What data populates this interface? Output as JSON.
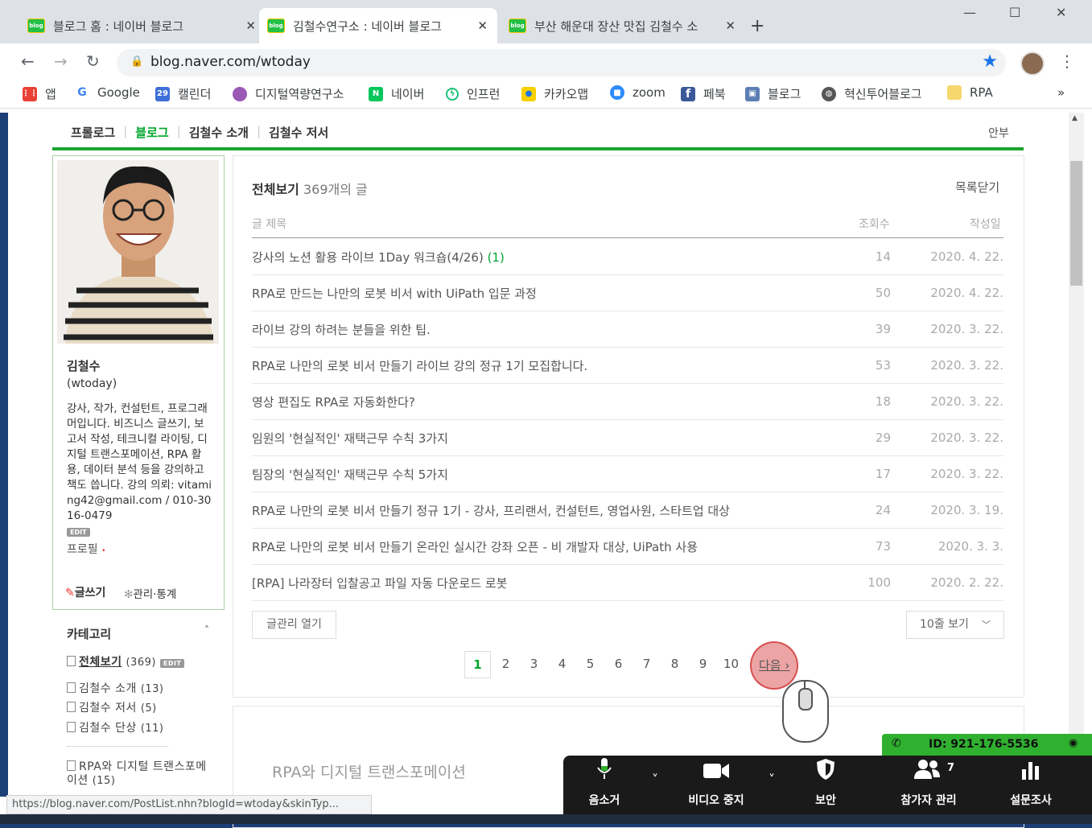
{
  "tabs": [
    {
      "title": "블로그 홈 : 네이버 블로그",
      "close": "✕"
    },
    {
      "title": "김철수연구소 : 네이버 블로그",
      "close": "✕"
    },
    {
      "title": "부산 해운대 장산 맛집 김철수 소",
      "close": "✕"
    }
  ],
  "favicon_text": "blog",
  "new_tab": "+",
  "window_controls": {
    "min": "—",
    "max": "☐",
    "close": "✕"
  },
  "nav": {
    "back": "←",
    "forward": "→",
    "reload": "↻",
    "menu": "⋮"
  },
  "address": {
    "url": "blog.naver.com/wtoday",
    "lock": "🔒",
    "star": "★"
  },
  "bookmarks": [
    {
      "label": "앱",
      "icon": "apps-icon",
      "color": "#e94235"
    },
    {
      "label": "Google",
      "icon": "google-icon",
      "color": "#4285f4"
    },
    {
      "label": "캘린더",
      "icon": "calendar-icon",
      "color": "#3f6fd8"
    },
    {
      "label": "디지털역량연구소",
      "icon": "person-icon",
      "color": "#9b59b6"
    },
    {
      "label": "네이버",
      "icon": "naver-icon",
      "color": "#03c75a"
    },
    {
      "label": "인프런",
      "icon": "inflearn-icon",
      "color": "#1dc078"
    },
    {
      "label": "카카오맵",
      "icon": "map-pin-icon",
      "color": "#f7d000"
    },
    {
      "label": "zoom",
      "icon": "zoom-icon",
      "color": "#2d8cff"
    },
    {
      "label": "페북",
      "icon": "facebook-icon",
      "color": "#3b5998"
    },
    {
      "label": "블로그",
      "icon": "truck-icon",
      "color": "#5b7fb5"
    },
    {
      "label": "혁신투어블로그",
      "icon": "globe-icon",
      "color": "#555555"
    },
    {
      "label": "RPA",
      "icon": "folder-icon",
      "color": "#f5d76e"
    }
  ],
  "bookmarks_more": "»",
  "blog_menu": [
    "프롤로그",
    "블로그",
    "김철수 소개",
    "김철수 저서"
  ],
  "blog_menu_sep": "|",
  "anbu": "안부",
  "profile": {
    "name": "김철수",
    "id": "(wtoday)",
    "description": "강사, 작가, 컨설턴트, 프로그래머입니다. 비즈니스 글쓰기, 보고서 작성, 테크니컬 라이팅, 디지털 트랜스포메이션, RPA 활용, 데이터 분석 등을 강의하고 책도 씁니다. 강의 의뢰: vitaming42@gmail.com / 010-3016-0479",
    "edit": "EDIT",
    "profile_link": "프로필",
    "profile_dot": "•",
    "write": "글쓰기",
    "manage": "관리·통계"
  },
  "categories": {
    "title": "카테고리",
    "caret": "˄",
    "items": [
      {
        "label": "전체보기",
        "count": "(369)",
        "edit": "EDIT"
      },
      {
        "label": "김철수 소개",
        "count": "(13)"
      },
      {
        "label": "김철수 저서",
        "count": "(5)"
      },
      {
        "label": "김철수 단상",
        "count": "(11)"
      },
      {
        "label": "RPA와 디지털 트랜스포메이션",
        "count": "(15)"
      }
    ]
  },
  "list": {
    "title": "전체보기",
    "count": "369개의 글",
    "close": "목록닫기",
    "col_title": "글 제목",
    "col_views": "조회수",
    "col_date": "작성일",
    "rows": [
      {
        "title": "강사의 노션 활용 라이브 1Day 워크숍(4/26)",
        "comments": "(1)",
        "views": "14",
        "date": "2020. 4. 22."
      },
      {
        "title": "RPA로 만드는 나만의 로봇 비서 with UiPath 입문 과정",
        "comments": "",
        "views": "50",
        "date": "2020. 4. 22."
      },
      {
        "title": "라이브 강의 하려는 분들을 위한 팁.",
        "comments": "",
        "views": "39",
        "date": "2020. 3. 22."
      },
      {
        "title": "RPA로 나만의 로봇 비서 만들기 라이브 강의 정규 1기 모집합니다.",
        "comments": "",
        "views": "53",
        "date": "2020. 3. 22."
      },
      {
        "title": "영상 편집도 RPA로 자동화한다?",
        "comments": "",
        "views": "18",
        "date": "2020. 3. 22."
      },
      {
        "title": "임원의 '현실적인' 재택근무 수칙 3가지",
        "comments": "",
        "views": "29",
        "date": "2020. 3. 22."
      },
      {
        "title": "팀장의 '현실적인' 재택근무 수칙 5가지",
        "comments": "",
        "views": "17",
        "date": "2020. 3. 22."
      },
      {
        "title": "RPA로 나만의 로봇 비서 만들기 정규 1기 - 강사, 프리랜서, 컨설턴트, 영업사원, 스타트업 대상",
        "comments": "",
        "views": "24",
        "date": "2020. 3. 19."
      },
      {
        "title": "RPA로 나만의 로봇 비서 만들기 온라인 실시간 강좌 오픈 - 비 개발자 대상, UiPath 사용",
        "comments": "",
        "views": "73",
        "date": "2020. 3. 3."
      },
      {
        "title": "[RPA] 나라장터 입찰공고 파일 자동 다운로드 로봇",
        "comments": "",
        "views": "100",
        "date": "2020. 2. 22."
      }
    ],
    "manage_button": "글관리 열기",
    "rows_select": "10줄 보기",
    "pages": [
      "1",
      "2",
      "3",
      "4",
      "5",
      "6",
      "7",
      "8",
      "9",
      "10"
    ],
    "current_page": "1",
    "next": "다음"
  },
  "next_section_title": "RPA와 디지털 트랜스포메이션",
  "status_url": "https://blog.naver.com/PostList.nhn?blogId=wtoday&skinTyp...",
  "zoom": {
    "meeting_id": "ID: 921-176-5536",
    "buttons": [
      {
        "label": "음소거",
        "icon": "microphone-icon",
        "glyph": "🎤"
      },
      {
        "label": "비디오 중지",
        "icon": "video-camera-icon",
        "glyph": "■"
      },
      {
        "label": "보안",
        "icon": "shield-icon",
        "glyph": "⛨"
      },
      {
        "label": "참가자 관리",
        "icon": "participants-icon",
        "glyph": "👥"
      },
      {
        "label": "설문조사",
        "icon": "poll-icon",
        "glyph": "▮"
      }
    ],
    "participants_count": "7",
    "caret": "˅",
    "colors": {
      "id_bar": "#2fb12f",
      "toolbar": "#1a1a1a"
    }
  }
}
